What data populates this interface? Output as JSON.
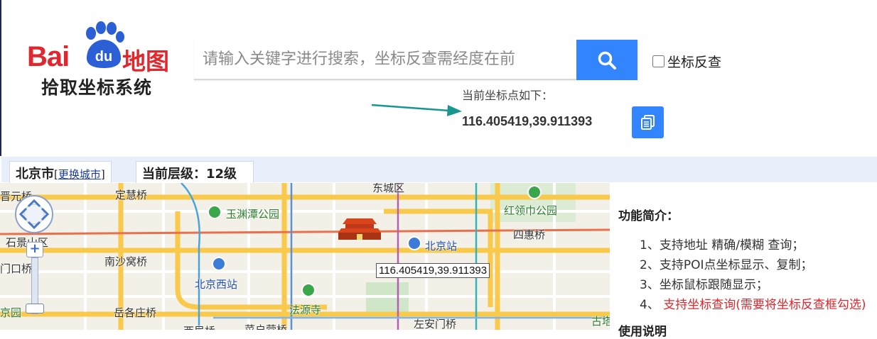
{
  "logo": {
    "brand_text": "Bai",
    "paw_text": "du",
    "cn_text": "地图",
    "subtitle": "拾取坐标系统"
  },
  "search": {
    "placeholder": "请输入关键字进行搜索，坐标反查需经度在前",
    "value": "",
    "button_icon": "search-icon"
  },
  "reverse_lookup": {
    "label": "坐标反查",
    "checked": false
  },
  "coord_output": {
    "label": "当前坐标点如下：",
    "value": "116.405419,39.911393",
    "copy_icon": "copy-icon"
  },
  "info_bar": {
    "city": "北京市",
    "change_city_open": "[",
    "change_city_link": "更换城市",
    "change_city_close": "]",
    "zoom_level": "当前层级：12级"
  },
  "map": {
    "tooltip": "116.405419,39.911393",
    "labels": [
      {
        "text": "晋元桥",
        "type": "normal"
      },
      {
        "text": "定慧桥",
        "type": "normal"
      },
      {
        "text": "东城区",
        "type": "normal"
      },
      {
        "text": "玉渊潭公园",
        "type": "green"
      },
      {
        "text": "红领巾公园",
        "type": "green"
      },
      {
        "text": "石景山区",
        "type": "normal"
      },
      {
        "text": "北京站",
        "type": "blue"
      },
      {
        "text": "四惠桥",
        "type": "normal"
      },
      {
        "text": "南沙窝桥",
        "type": "normal"
      },
      {
        "text": "门口桥",
        "type": "normal"
      },
      {
        "text": "北京西站",
        "type": "blue"
      },
      {
        "text": "法源寺",
        "type": "green"
      },
      {
        "text": "岳各庄桥",
        "type": "normal"
      },
      {
        "text": "京园",
        "type": "green"
      },
      {
        "text": "左安门桥",
        "type": "normal"
      },
      {
        "text": "西局桥",
        "type": "normal"
      },
      {
        "text": "菜户营桥",
        "type": "normal"
      },
      {
        "text": "古塔",
        "type": "green"
      }
    ],
    "controls": {
      "zoom_in": "+",
      "zoom_out": "−"
    }
  },
  "features": {
    "title": "功能简介：",
    "items": [
      {
        "num": "1、",
        "text": "支持地址 精确/模糊 查询；"
      },
      {
        "num": "2、",
        "text": "支持POI点坐标显示、复制；"
      },
      {
        "num": "3、",
        "text": "坐标鼠标跟随显示；"
      },
      {
        "num": "4、",
        "text": "支持坐标查询(需要将坐标反查框勾选)"
      }
    ]
  },
  "usage": {
    "title": "使用说明"
  },
  "colors": {
    "primary_blue": "#3385ff",
    "brand_red": "#e1262d",
    "info_bar_bg": "#e8eefa",
    "highlight_red": "#e0282e",
    "arrow_teal": "#17978f"
  }
}
